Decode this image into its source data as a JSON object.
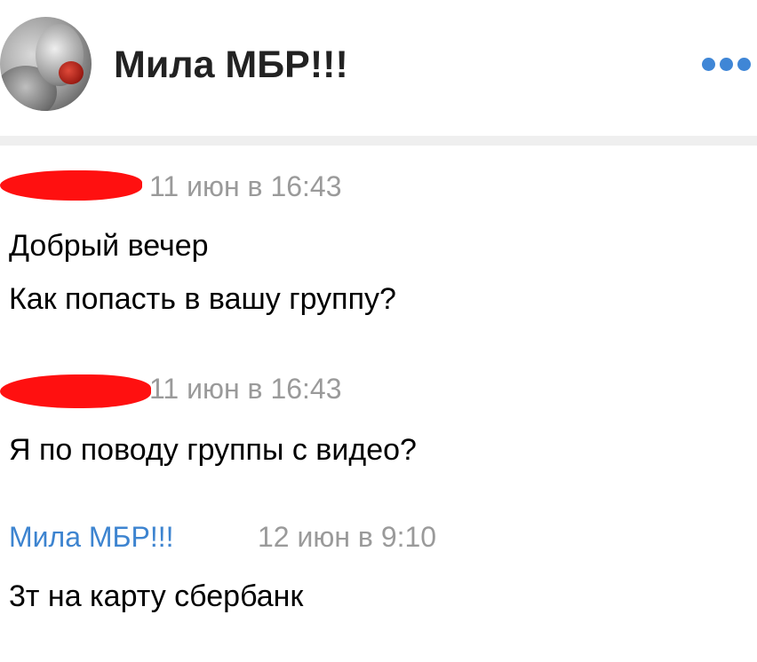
{
  "header": {
    "title": "Мила МБР!!!"
  },
  "messages": [
    {
      "author": "",
      "date": "11 июн в 16:43",
      "lines": [
        "Добрый вечер",
        "Как попасть в вашу группу?"
      ]
    },
    {
      "author": "",
      "date": "11 июн в 16:43",
      "lines": [
        "Я по поводу группы с видео?"
      ]
    },
    {
      "author": "Мила МБР!!!",
      "date": "12 июн в 9:10",
      "lines": [
        "3т на карту сбербанк"
      ]
    }
  ],
  "colors": {
    "accent": "#3f86d6",
    "date_gray": "#9a9a9a",
    "redaction": "#ff1010"
  }
}
